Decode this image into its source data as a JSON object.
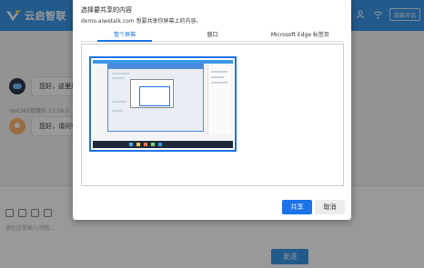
{
  "app": {
    "brand_name": "云启智联",
    "header_button": "结束对话",
    "messages": [
      {
        "text": "您好，这里是"
      },
      {
        "text": "您好，请问有"
      }
    ],
    "sender_line": "test365管理员 13:56:5",
    "input_placeholder": "请在这里输入问题...",
    "send_label": "发送"
  },
  "dialog": {
    "title": "选择要共享的内容",
    "subtitle": "demo.aiwetalk.com 想要共享你屏幕上的内容。",
    "tabs": [
      "整个屏幕",
      "窗口",
      "Microsoft Edge 标签页"
    ],
    "active_tab": 0,
    "share_label": "共享",
    "cancel_label": "取消"
  },
  "colors": {
    "header_blue": "#3a97e8",
    "accent_blue": "#1a73e8"
  }
}
